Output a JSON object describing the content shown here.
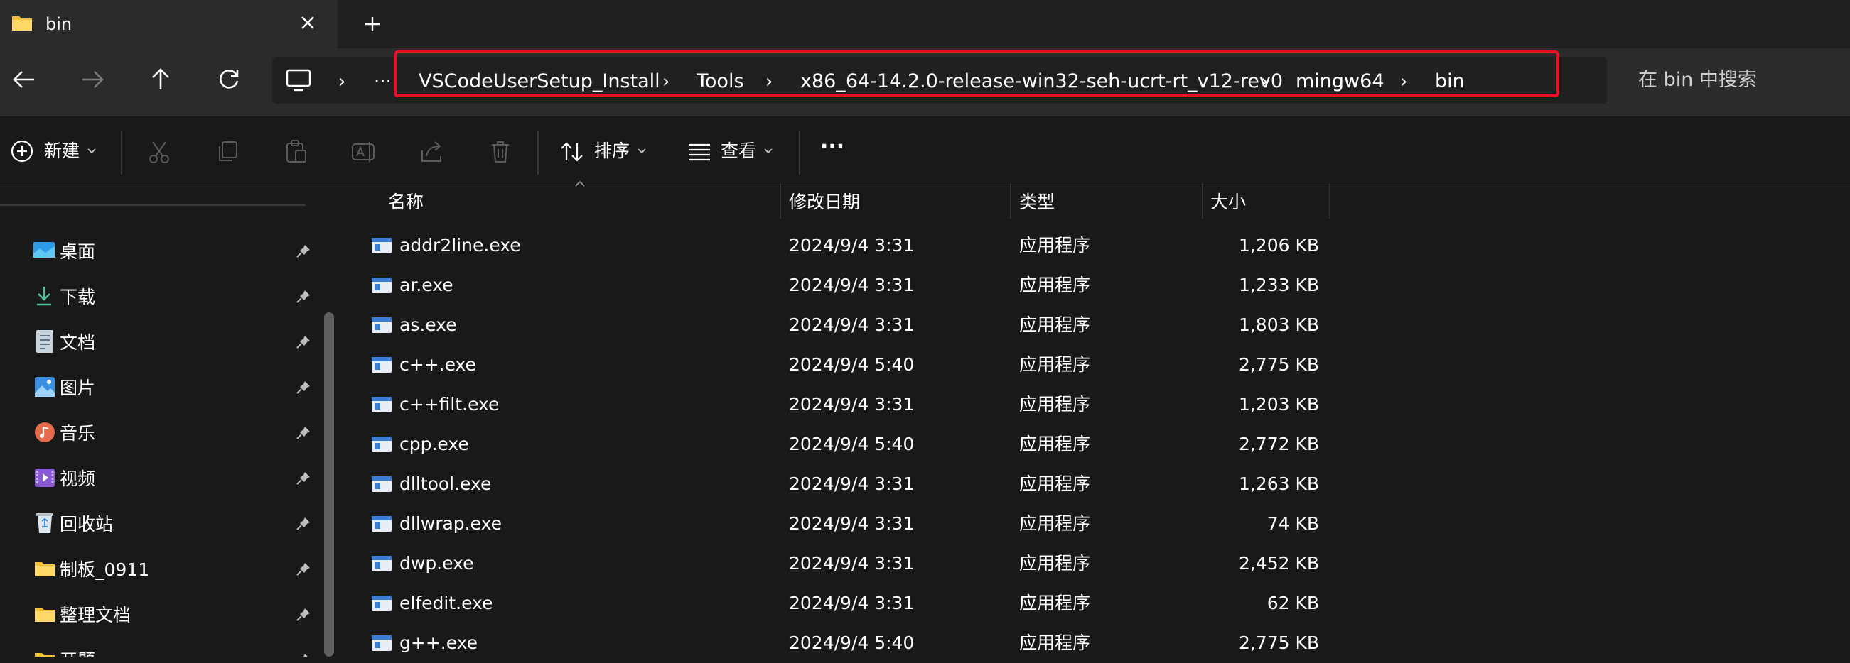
{
  "window": {
    "tab_title": "bin",
    "tab_close_icon": "close-icon",
    "new_tab_icon": "plus-icon"
  },
  "address_bar": {
    "breadcrumbs": [
      "VSCodeUserSetup_Install",
      "Tools",
      "x86_64-14.2.0-release-win32-seh-ucrt-rt_v12-rev0",
      "mingw64",
      "bin"
    ],
    "separator": "›",
    "overflow": "···",
    "highlight_color": "#e81123"
  },
  "search": {
    "placeholder": "在 bin 中搜索"
  },
  "toolbar": {
    "new_label": "新建",
    "sort_label": "排序",
    "view_label": "查看",
    "more_label": "···"
  },
  "sidebar": {
    "items": [
      {
        "label": "桌面",
        "icon": "desktop-icon"
      },
      {
        "label": "下载",
        "icon": "download-icon"
      },
      {
        "label": "文档",
        "icon": "document-icon"
      },
      {
        "label": "图片",
        "icon": "picture-icon"
      },
      {
        "label": "音乐",
        "icon": "music-icon"
      },
      {
        "label": "视频",
        "icon": "video-icon"
      },
      {
        "label": "回收站",
        "icon": "recycle-bin-icon"
      },
      {
        "label": "制板_0911",
        "icon": "folder-icon"
      },
      {
        "label": "整理文档",
        "icon": "folder-icon"
      },
      {
        "label": "开题",
        "icon": "folder-icon"
      }
    ]
  },
  "file_list": {
    "columns": [
      "名称",
      "修改日期",
      "类型",
      "大小"
    ],
    "rows": [
      {
        "name": "addr2line.exe",
        "date": "2024/9/4 3:31",
        "type": "应用程序",
        "size": "1,206 KB"
      },
      {
        "name": "ar.exe",
        "date": "2024/9/4 3:31",
        "type": "应用程序",
        "size": "1,233 KB"
      },
      {
        "name": "as.exe",
        "date": "2024/9/4 3:31",
        "type": "应用程序",
        "size": "1,803 KB"
      },
      {
        "name": "c++.exe",
        "date": "2024/9/4 5:40",
        "type": "应用程序",
        "size": "2,775 KB"
      },
      {
        "name": "c++filt.exe",
        "date": "2024/9/4 3:31",
        "type": "应用程序",
        "size": "1,203 KB"
      },
      {
        "name": "cpp.exe",
        "date": "2024/9/4 5:40",
        "type": "应用程序",
        "size": "2,772 KB"
      },
      {
        "name": "dlltool.exe",
        "date": "2024/9/4 3:31",
        "type": "应用程序",
        "size": "1,263 KB"
      },
      {
        "name": "dllwrap.exe",
        "date": "2024/9/4 3:31",
        "type": "应用程序",
        "size": "74 KB"
      },
      {
        "name": "dwp.exe",
        "date": "2024/9/4 3:31",
        "type": "应用程序",
        "size": "2,452 KB"
      },
      {
        "name": "elfedit.exe",
        "date": "2024/9/4 3:31",
        "type": "应用程序",
        "size": "62 KB"
      },
      {
        "name": "g++.exe",
        "date": "2024/9/4 5:40",
        "type": "应用程序",
        "size": "2,775 KB"
      }
    ]
  }
}
